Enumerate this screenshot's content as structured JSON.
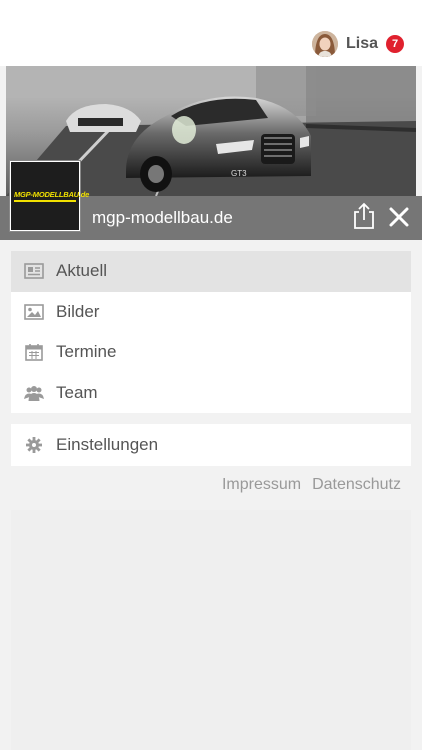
{
  "user": {
    "name": "Lisa",
    "notifications": "7"
  },
  "site": {
    "title": "mgp-modellbau.de",
    "logo_text": "MGP-MODELLBAU.de"
  },
  "menu": {
    "items": [
      {
        "label": "Aktuell",
        "icon": "newspaper-icon",
        "active": true
      },
      {
        "label": "Bilder",
        "icon": "image-icon",
        "active": false
      },
      {
        "label": "Termine",
        "icon": "calendar-icon",
        "active": false
      },
      {
        "label": "Team",
        "icon": "team-icon",
        "active": false
      }
    ]
  },
  "settings": {
    "label": "Einstellungen",
    "icon": "gear-icon"
  },
  "footer": {
    "impressum": "Impressum",
    "datenschutz": "Datenschutz"
  },
  "colors": {
    "badge": "#e0212e",
    "site_bar": "#767676",
    "active_item": "#e3e3e3",
    "logo_accent": "#f2e100"
  }
}
